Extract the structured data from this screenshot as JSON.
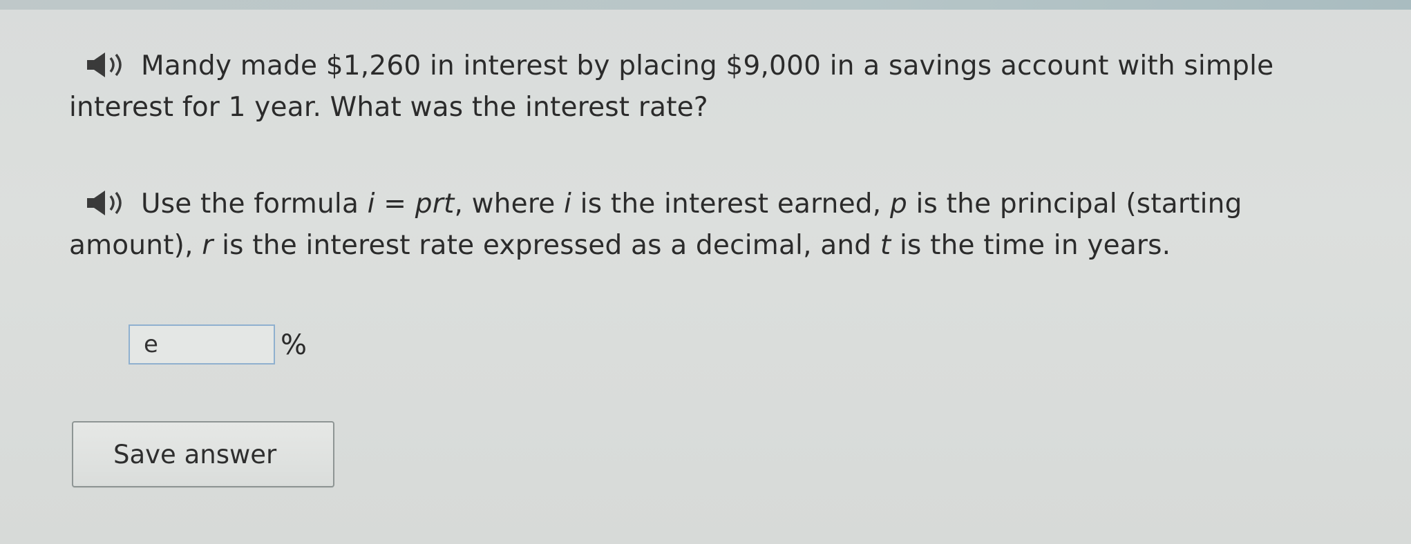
{
  "question": {
    "speaker_icon": "speaker-icon",
    "text": "Mandy made $1,260 in interest by placing $9,000 in a savings account with simple interest for 1 year. What was the interest rate?"
  },
  "hint": {
    "speaker_icon": "speaker-icon",
    "text_before_formula": "Use the formula ",
    "formula_i": "i",
    "formula_eq": " = ",
    "formula_prt": "prt",
    "text_where": ", where ",
    "var_i": "i",
    "text_i_desc": " is the interest earned, ",
    "var_p": "p",
    "text_p_desc": " is the principal (starting amount), ",
    "var_r": "r",
    "text_r_desc": " is the interest rate expressed as a decimal, and ",
    "var_t": "t",
    "text_t_desc": " is the time in years."
  },
  "answer": {
    "value": "e",
    "unit": "%"
  },
  "actions": {
    "save_label": "Save answer"
  },
  "colors": {
    "background": "#dcdfdd",
    "text": "#2b2b2b",
    "input_border": "#8fb0cf",
    "button_border": "#8e9594"
  }
}
